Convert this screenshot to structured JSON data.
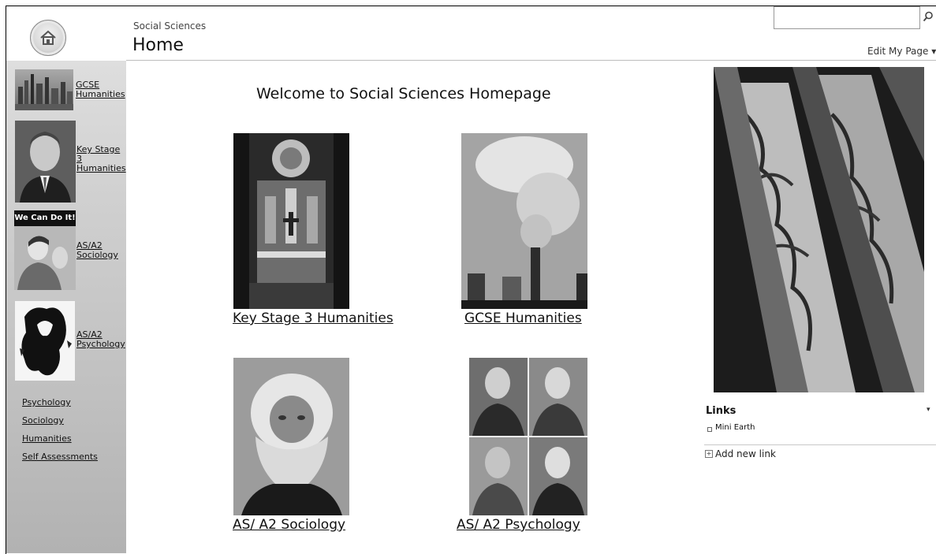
{
  "header": {
    "site_name": "Social Sciences",
    "page_title": "Home",
    "search_placeholder": "",
    "edit_page_label": "Edit My Page ▾"
  },
  "left_nav": {
    "items": [
      {
        "label": "GCSE Humanities",
        "icon": "city-skyline-photo"
      },
      {
        "label": "Key Stage 3 Humanities",
        "icon": "portrait-photo"
      },
      {
        "label": "AS/A2 Sociology",
        "icon": "we-can-do-it-poster"
      },
      {
        "label": "AS/A2 Psychology",
        "icon": "inkblot-image"
      }
    ],
    "thumb_caption": "We Can Do It!",
    "quick_links": [
      "Psychology",
      "Sociology",
      "Humanities",
      "Self Assessments"
    ]
  },
  "main": {
    "welcome": "Welcome to Social Sciences Homepage",
    "tiles": [
      {
        "label": "Key Stage 3 Humanities",
        "icon": "cathedral-altar-photo"
      },
      {
        "label": "GCSE Humanities",
        "icon": "smokestack-photo"
      },
      {
        "label": "AS/ A2 Sociology",
        "icon": "bearded-man-portrait"
      },
      {
        "label": "AS/ A2 Psychology",
        "icon": "four-panel-portrait"
      }
    ]
  },
  "links_panel": {
    "title": "Links",
    "items": [
      "Mini Earth"
    ],
    "add_label": "Add new link"
  },
  "colors": {
    "sidebar_top": "#dedede",
    "sidebar_bottom": "#b2b2b2",
    "text": "#111111"
  }
}
